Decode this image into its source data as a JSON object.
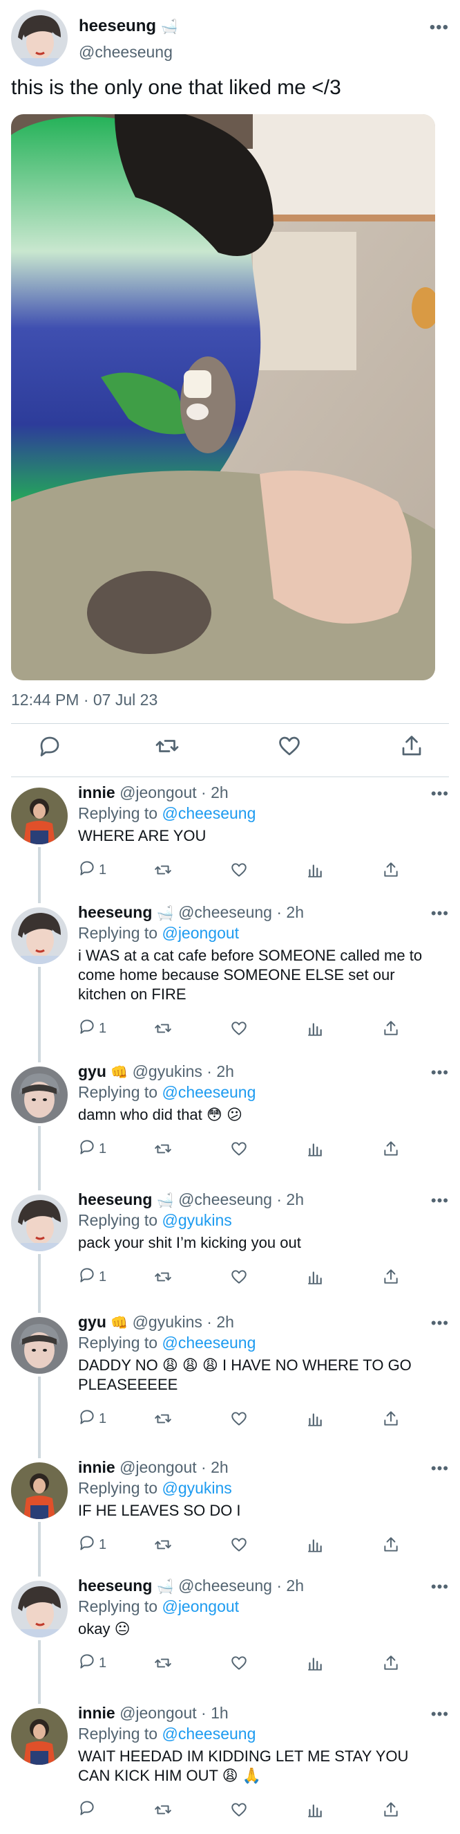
{
  "main_tweet": {
    "name": "heeseung",
    "name_emoji": "🛁",
    "handle": "@cheeseung",
    "text": "this is the only one that liked me </3",
    "timestamp": "12:44 PM · 07 Jul 23",
    "more_icon": "more-icon"
  },
  "replies": [
    {
      "name": "innie",
      "emoji": "",
      "handle": "@jeongout",
      "time": "2h",
      "replying_prefix": "Replying to ",
      "replying_to": "@cheeseung",
      "text": "WHERE ARE YOU",
      "reply_count": "1"
    },
    {
      "name": "heeseung",
      "emoji": "🛁",
      "handle": "@cheeseung",
      "time": "2h",
      "replying_prefix": "Replying to ",
      "replying_to": "@jeongout",
      "text": "i WAS at a cat cafe before SOMEONE called me to come home because SOMEONE ELSE set our kitchen on FIRE",
      "reply_count": "1"
    },
    {
      "name": "gyu",
      "emoji": "👊",
      "handle": "@gyukins",
      "time": "2h",
      "replying_prefix": "Replying to ",
      "replying_to": "@cheeseung",
      "text": "damn who did that 😳 😕",
      "reply_count": "1"
    },
    {
      "name": "heeseung",
      "emoji": "🛁",
      "handle": "@cheeseung",
      "time": "2h",
      "replying_prefix": "Replying to ",
      "replying_to": "@gyukins",
      "text": "pack your shit I’m kicking you out",
      "reply_count": "1"
    },
    {
      "name": "gyu",
      "emoji": "👊",
      "handle": "@gyukins",
      "time": "2h",
      "replying_prefix": "Replying to ",
      "replying_to": "@cheeseung",
      "text": "DADDY NO 😩 😩 😩  I HAVE NO WHERE TO GO PLEASEEEEE",
      "reply_count": "1"
    },
    {
      "name": "innie",
      "emoji": "",
      "handle": "@jeongout",
      "time": "2h",
      "replying_prefix": "Replying to ",
      "replying_to": "@gyukins",
      "text": "IF HE LEAVES SO DO I",
      "reply_count": "1"
    },
    {
      "name": "heeseung",
      "emoji": "🛁",
      "handle": "@cheeseung",
      "time": "2h",
      "replying_prefix": "Replying to ",
      "replying_to": "@jeongout",
      "text": "okay 😐",
      "reply_count": "1"
    },
    {
      "name": "innie",
      "emoji": "",
      "handle": "@jeongout",
      "time": "1h",
      "replying_prefix": "Replying to ",
      "replying_to": "@cheeseung",
      "text": "WAIT HEEDAD IM KIDDING LET ME STAY YOU CAN KICK HIM OUT 😩 🙏",
      "reply_count": ""
    }
  ],
  "colors": {
    "link": "#1d9bf0",
    "muted": "#536471",
    "divider": "#cfd9de"
  }
}
